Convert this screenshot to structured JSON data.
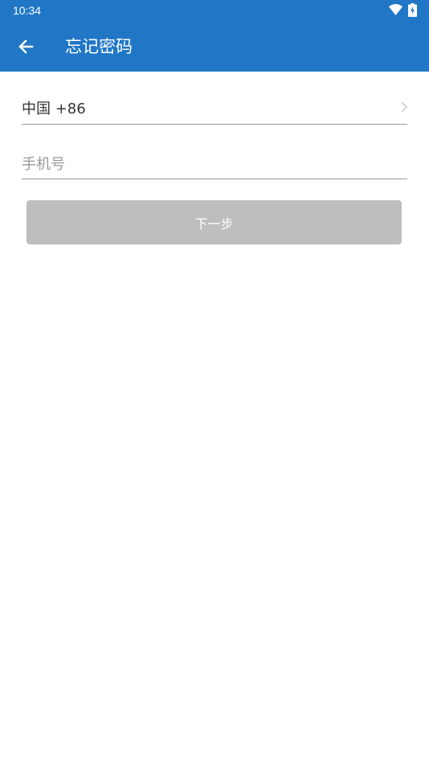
{
  "status_bar": {
    "time": "10:34",
    "wifi_icon": "wifi-icon",
    "battery_icon": "battery-charging-icon"
  },
  "toolbar": {
    "back_icon": "arrow-left-icon",
    "title": "忘记密码",
    "background_color": "#2177c6"
  },
  "form": {
    "country": {
      "label": "中国 +86",
      "icon": "chevron-right-icon"
    },
    "phone": {
      "value": "",
      "placeholder": "手机号"
    },
    "next_button": {
      "label": "下一步",
      "enabled": false,
      "background_color": "#bebebe"
    }
  }
}
